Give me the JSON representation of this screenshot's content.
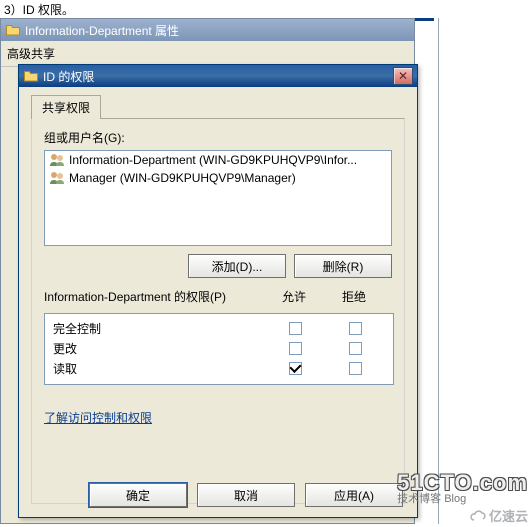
{
  "caption": "3）ID 权限。",
  "parent_window": {
    "title": "Information-Department 属性",
    "adv_share": "高级共享"
  },
  "dialog": {
    "title": "ID 的权限",
    "tab": "共享权限",
    "group_label": "组或用户名(G):",
    "users": [
      {
        "name": "Information-Department (WIN-GD9KPUHQVP9\\Infor..."
      },
      {
        "name": "Manager (WIN-GD9KPUHQVP9\\Manager)"
      }
    ],
    "add_btn": "添加(D)...",
    "remove_btn": "删除(R)",
    "perm_for_label": "Information-Department 的权限(P)",
    "col_allow": "允许",
    "col_deny": "拒绝",
    "perms": [
      {
        "name": "完全控制",
        "allow": false,
        "deny": false
      },
      {
        "name": "更改",
        "allow": false,
        "deny": false
      },
      {
        "name": "读取",
        "allow": true,
        "deny": false
      }
    ],
    "link": "了解访问控制和权限",
    "ok": "确定",
    "cancel": "取消",
    "apply": "应用(A)"
  },
  "watermarks": {
    "w1_big": "51CTO.com",
    "w1_small": "技术博客    Blog",
    "w2": "亿速云"
  }
}
